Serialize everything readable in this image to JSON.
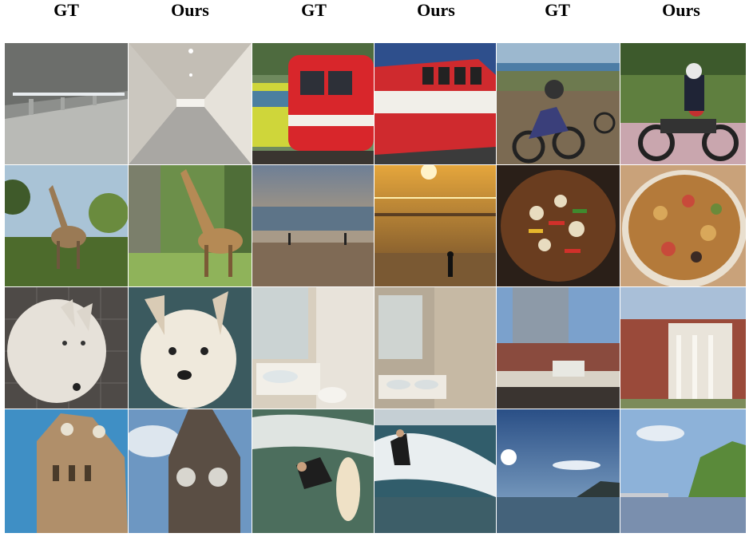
{
  "headers": [
    "GT",
    "Ours",
    "GT",
    "Ours",
    "GT",
    "Ours"
  ]
}
